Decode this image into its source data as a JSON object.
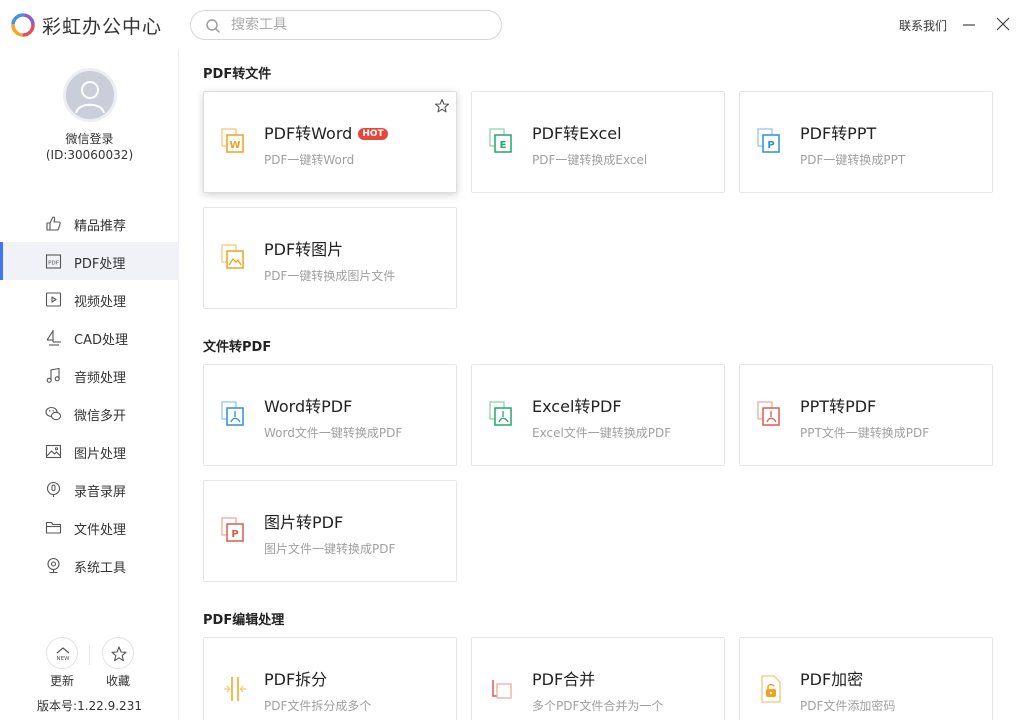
{
  "app": {
    "title": "彩虹办公中心",
    "search_placeholder": "搜索工具",
    "contact_label": "联系我们"
  },
  "user": {
    "login_label": "微信登录",
    "id_label": "(ID:30060032)"
  },
  "sidebar": {
    "items": [
      {
        "label": "精品推荐",
        "icon": "thumbs-up-icon",
        "active": false
      },
      {
        "label": "PDF处理",
        "icon": "pdf-icon",
        "active": true
      },
      {
        "label": "视频处理",
        "icon": "video-play-icon",
        "active": false
      },
      {
        "label": "CAD处理",
        "icon": "cad-icon",
        "active": false
      },
      {
        "label": "音频处理",
        "icon": "music-note-icon",
        "active": false
      },
      {
        "label": "微信多开",
        "icon": "wechat-icon",
        "active": false
      },
      {
        "label": "图片处理",
        "icon": "image-icon",
        "active": false
      },
      {
        "label": "录音录屏",
        "icon": "record-icon",
        "active": false
      },
      {
        "label": "文件处理",
        "icon": "folder-icon",
        "active": false
      },
      {
        "label": "系统工具",
        "icon": "system-tool-icon",
        "active": false
      }
    ],
    "update_label": "更新",
    "update_badge": "NEW",
    "favorite_label": "收藏",
    "version_label": "版本号:1.22.9.231"
  },
  "sections": [
    {
      "title": "PDF转文件",
      "cards": [
        {
          "title": "PDF转Word",
          "desc": "PDF一键转Word",
          "badge": "HOT",
          "icon": "word-doc-icon",
          "color": "#f0a21b"
        },
        {
          "title": "PDF转Excel",
          "desc": "PDF一键转换成Excel",
          "icon": "excel-doc-icon",
          "color": "#27a66d"
        },
        {
          "title": "PDF转PPT",
          "desc": "PDF一键转换成PPT",
          "icon": "ppt-doc-icon",
          "color": "#2f8fd8"
        },
        {
          "title": "PDF转图片",
          "desc": "PDF一键转换成图片文件",
          "icon": "image-doc-icon",
          "color": "#f0a21b"
        }
      ]
    },
    {
      "title": "文件转PDF",
      "cards": [
        {
          "title": "Word转PDF",
          "desc": "Word文件一键转换成PDF",
          "icon": "word-to-pdf-icon",
          "color": "#2f8fd8"
        },
        {
          "title": "Excel转PDF",
          "desc": "Excel文件一键转换成PDF",
          "icon": "excel-to-pdf-icon",
          "color": "#27a66d"
        },
        {
          "title": "PPT转PDF",
          "desc": "PPT文件一键转换成PDF",
          "icon": "ppt-to-pdf-icon",
          "color": "#e05a4f"
        },
        {
          "title": "图片转PDF",
          "desc": "图片文件一键转换成PDF",
          "icon": "image-to-pdf-icon",
          "color": "#e05a4f"
        }
      ]
    },
    {
      "title": "PDF编辑处理",
      "cards": [
        {
          "title": "PDF拆分",
          "desc": "PDF文件拆分成多个",
          "icon": "split-icon",
          "color": "#f0a21b"
        },
        {
          "title": "PDF合并",
          "desc": "多个PDF文件合并为一个",
          "icon": "merge-icon",
          "color": "#e05a4f"
        },
        {
          "title": "PDF加密",
          "desc": "PDF文件添加密码",
          "icon": "lock-doc-icon",
          "color": "#f0a21b"
        }
      ]
    }
  ]
}
